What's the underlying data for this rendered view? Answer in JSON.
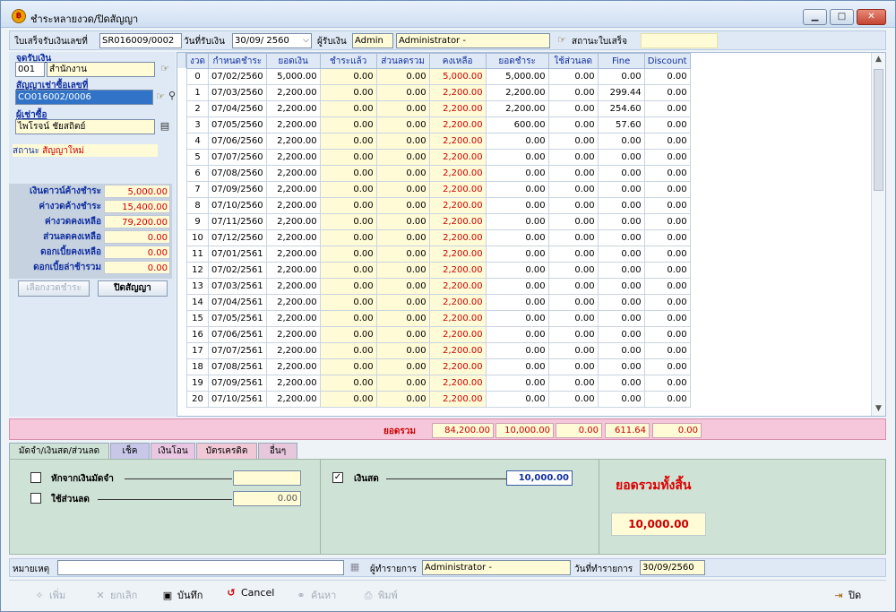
{
  "window": {
    "title": "ชำระหลายงวด/ปิดสัญญา",
    "minimize": "▁",
    "maximize": "□",
    "close": "✕"
  },
  "header": {
    "receipt_no_label": "ใบเสร็จรับเงินเลขที่",
    "receipt_no": "SR016009/0002",
    "date_label": "วันที่รับเงิน",
    "date": "30/09/ 2560",
    "receiver_label": "ผู้รับเงิน",
    "receiver_code": "Admin",
    "receiver_name": "Administrator -",
    "status_label": "สถานะใบเสร็จ",
    "status_value": ""
  },
  "left": {
    "payment_point_label": "จุดรับเงิน",
    "payment_point_code": "001",
    "payment_point_name": "สำนักงาน",
    "contract_label": "สัญญาเช่าซื้อเลขที่",
    "contract_no": "CO016002/0006",
    "customer_label": "ผู้เช่าซื้อ",
    "customer_name": "ไพโรจน์ ชัยสถิตย์",
    "status_key": "สถานะ",
    "status_value": "สัญญาใหม่",
    "summary": [
      {
        "label": "เงินดาวน์ค้างชำระ",
        "value": "5,000.00"
      },
      {
        "label": "ค่างวดค้างชำระ",
        "value": "15,400.00"
      },
      {
        "label": "ค่างวดคงเหลือ",
        "value": "79,200.00"
      },
      {
        "label": "ส่วนลดคงเหลือ",
        "value": "0.00"
      },
      {
        "label": "ดอกเบี้ยคงเหลือ",
        "value": "0.00"
      },
      {
        "label": "ดอกเบี้ยล่าช้ารวม",
        "value": "0.00"
      }
    ],
    "select_period_btn": "เลือกงวดชำระ",
    "close_contract_btn": "ปิดสัญญา"
  },
  "grid": {
    "columns": [
      "งวด",
      "กำหนดชำระ",
      "ยอดเงิน",
      "ชำระแล้ว",
      "ส่วนลดรวม",
      "คงเหลือ",
      "ยอดชำระ",
      "ใช้ส่วนลด",
      "Fine",
      "Discount"
    ],
    "rows": [
      [
        "0",
        "07/02/2560",
        "5,000.00",
        "0.00",
        "0.00",
        "5,000.00",
        "5,000.00",
        "0.00",
        "0.00",
        "0.00"
      ],
      [
        "1",
        "07/03/2560",
        "2,200.00",
        "0.00",
        "0.00",
        "2,200.00",
        "2,200.00",
        "0.00",
        "299.44",
        "0.00"
      ],
      [
        "2",
        "07/04/2560",
        "2,200.00",
        "0.00",
        "0.00",
        "2,200.00",
        "2,200.00",
        "0.00",
        "254.60",
        "0.00"
      ],
      [
        "3",
        "07/05/2560",
        "2,200.00",
        "0.00",
        "0.00",
        "2,200.00",
        "600.00",
        "0.00",
        "57.60",
        "0.00"
      ],
      [
        "4",
        "07/06/2560",
        "2,200.00",
        "0.00",
        "0.00",
        "2,200.00",
        "0.00",
        "0.00",
        "0.00",
        "0.00"
      ],
      [
        "5",
        "07/07/2560",
        "2,200.00",
        "0.00",
        "0.00",
        "2,200.00",
        "0.00",
        "0.00",
        "0.00",
        "0.00"
      ],
      [
        "6",
        "07/08/2560",
        "2,200.00",
        "0.00",
        "0.00",
        "2,200.00",
        "0.00",
        "0.00",
        "0.00",
        "0.00"
      ],
      [
        "7",
        "07/09/2560",
        "2,200.00",
        "0.00",
        "0.00",
        "2,200.00",
        "0.00",
        "0.00",
        "0.00",
        "0.00"
      ],
      [
        "8",
        "07/10/2560",
        "2,200.00",
        "0.00",
        "0.00",
        "2,200.00",
        "0.00",
        "0.00",
        "0.00",
        "0.00"
      ],
      [
        "9",
        "07/11/2560",
        "2,200.00",
        "0.00",
        "0.00",
        "2,200.00",
        "0.00",
        "0.00",
        "0.00",
        "0.00"
      ],
      [
        "10",
        "07/12/2560",
        "2,200.00",
        "0.00",
        "0.00",
        "2,200.00",
        "0.00",
        "0.00",
        "0.00",
        "0.00"
      ],
      [
        "11",
        "07/01/2561",
        "2,200.00",
        "0.00",
        "0.00",
        "2,200.00",
        "0.00",
        "0.00",
        "0.00",
        "0.00"
      ],
      [
        "12",
        "07/02/2561",
        "2,200.00",
        "0.00",
        "0.00",
        "2,200.00",
        "0.00",
        "0.00",
        "0.00",
        "0.00"
      ],
      [
        "13",
        "07/03/2561",
        "2,200.00",
        "0.00",
        "0.00",
        "2,200.00",
        "0.00",
        "0.00",
        "0.00",
        "0.00"
      ],
      [
        "14",
        "07/04/2561",
        "2,200.00",
        "0.00",
        "0.00",
        "2,200.00",
        "0.00",
        "0.00",
        "0.00",
        "0.00"
      ],
      [
        "15",
        "07/05/2561",
        "2,200.00",
        "0.00",
        "0.00",
        "2,200.00",
        "0.00",
        "0.00",
        "0.00",
        "0.00"
      ],
      [
        "16",
        "07/06/2561",
        "2,200.00",
        "0.00",
        "0.00",
        "2,200.00",
        "0.00",
        "0.00",
        "0.00",
        "0.00"
      ],
      [
        "17",
        "07/07/2561",
        "2,200.00",
        "0.00",
        "0.00",
        "2,200.00",
        "0.00",
        "0.00",
        "0.00",
        "0.00"
      ],
      [
        "18",
        "07/08/2561",
        "2,200.00",
        "0.00",
        "0.00",
        "2,200.00",
        "0.00",
        "0.00",
        "0.00",
        "0.00"
      ],
      [
        "19",
        "07/09/2561",
        "2,200.00",
        "0.00",
        "0.00",
        "2,200.00",
        "0.00",
        "0.00",
        "0.00",
        "0.00"
      ],
      [
        "20",
        "07/10/2561",
        "2,200.00",
        "0.00",
        "0.00",
        "2,200.00",
        "0.00",
        "0.00",
        "0.00",
        "0.00"
      ]
    ]
  },
  "totals": {
    "label": "ยอดรวม",
    "outstanding": "84,200.00",
    "payment": "10,000.00",
    "discount_used": "0.00",
    "fine": "611.64",
    "discount": "0.00"
  },
  "tabs": [
    {
      "label": "มัดจำ/เงินสด/ส่วนลด",
      "color": "#cfe2d6"
    },
    {
      "label": "เช็ค",
      "color": "#c9c7e8"
    },
    {
      "label": "เงินโอน",
      "color": "#e9c7e3"
    },
    {
      "label": "บัตรเครดิต",
      "color": "#f1c8d6"
    },
    {
      "label": "อื่นๆ",
      "color": "#e6c7dc"
    }
  ],
  "payment": {
    "deposit_deduct_label": "หักจากเงินมัดจำ",
    "deposit_deduct_checked": false,
    "deposit_deduct_value": "",
    "use_discount_label": "ใช้ส่วนลด",
    "use_discount_checked": false,
    "use_discount_value": "0.00",
    "cash_label": "เงินสด",
    "cash_checked": true,
    "cash_value": "10,000.00",
    "grand_total_label": "ยอดรวมทั้งสิ้น",
    "grand_total_value": "10,000.00"
  },
  "footer": {
    "remark_label": "หมายเหตุ",
    "remark_value": "",
    "operator_label": "ผู้ทำรายการ",
    "operator_value": "Administrator -",
    "op_date_label": "วันที่ทำรายการ",
    "op_date_value": "30/09/2560"
  },
  "toolbar": {
    "add": "เพิ่ม",
    "cancel_th": "ยกเลิก",
    "save": "บันทึก",
    "cancel": "Cancel",
    "search": "ค้นหา",
    "print": "พิมพ์",
    "close": "ปิด"
  },
  "colors": {
    "accent_red": "#cc0000",
    "label_blue": "#102fa0",
    "cell_yellow": "#fffbd6",
    "total_pink": "#f6c6da"
  }
}
